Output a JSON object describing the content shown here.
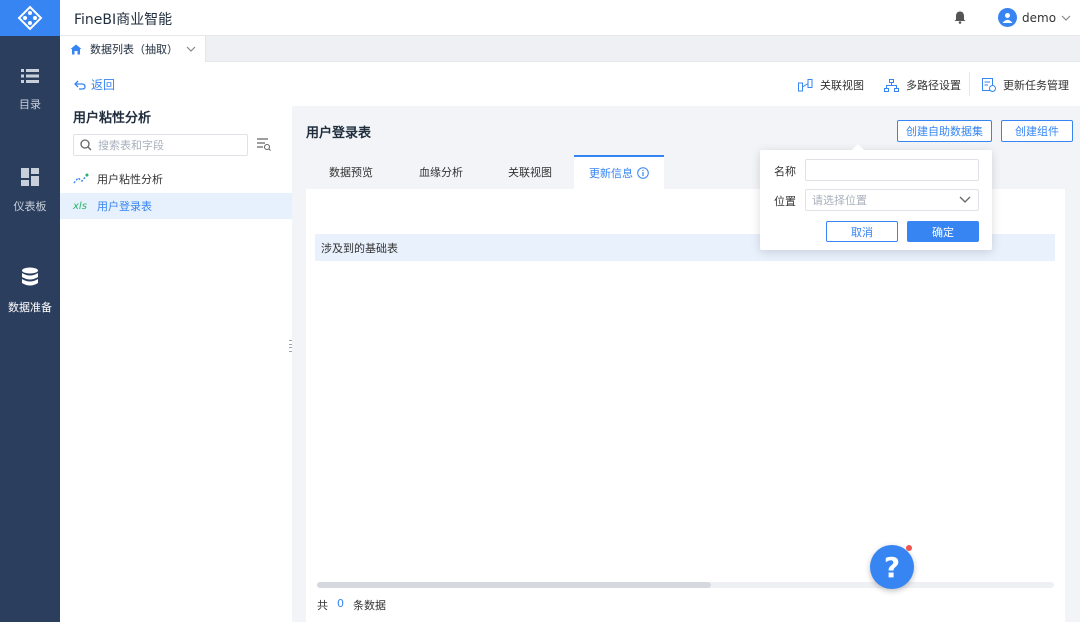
{
  "app": {
    "title": "FineBI商业智能"
  },
  "rail": {
    "items": [
      {
        "label": "目录",
        "icon": "list-icon"
      },
      {
        "label": "仪表板",
        "icon": "dashboard-icon"
      },
      {
        "label": "数据准备",
        "icon": "database-icon",
        "active": true
      }
    ]
  },
  "header": {
    "user": "demo"
  },
  "tabstrip": {
    "active_tab": "数据列表（抽取）"
  },
  "toolbar": {
    "back": "返回",
    "relation_view": "关联视图",
    "multipath": "多路径设置",
    "update_task": "更新任务管理"
  },
  "left": {
    "title": "用户粘性分析",
    "search_placeholder": "搜索表和字段",
    "tree": [
      {
        "label": "用户粘性分析",
        "icon": "analysis-icon"
      },
      {
        "label": "用户登录表",
        "type_badge": "xls",
        "selected": true
      }
    ]
  },
  "main": {
    "title": "用户登录表",
    "create_dataset": "创建自助数据集",
    "create_component": "创建组件",
    "tabs": [
      {
        "label": "数据预览"
      },
      {
        "label": "血缘分析"
      },
      {
        "label": "关联视图"
      },
      {
        "label": "更新信息",
        "active": true
      }
    ],
    "table_header": "涉及到的基础表",
    "footer": {
      "prefix": "共",
      "count": "0",
      "suffix": "条数据"
    }
  },
  "popup": {
    "name_label": "名称",
    "name_value": "",
    "location_label": "位置",
    "location_placeholder": "请选择位置",
    "cancel": "取消",
    "ok": "确定"
  },
  "colors": {
    "accent": "#3685f2",
    "rail": "#2c3e5d",
    "selected_row": "#e7f0fd"
  }
}
